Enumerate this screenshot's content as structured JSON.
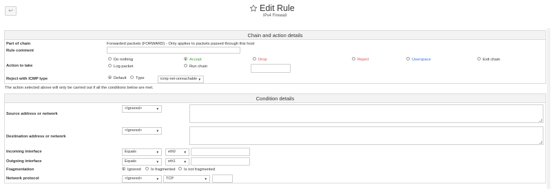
{
  "header": {
    "back_icon": "arrow-left",
    "title": "Edit Rule",
    "subtitle": "IPv4 Firewall",
    "star_icon": "star-outline"
  },
  "chain_section": {
    "heading": "Chain and action details",
    "part_of_chain_label": "Part of chain",
    "part_of_chain_value": "Forwarded packets (FORWARD) - Only applies to packets passed through this host",
    "rule_comment_label": "Rule comment",
    "rule_comment_value": "",
    "action_label": "Action to take",
    "actions": [
      {
        "label": "Do nothing",
        "selected": false,
        "color": "#333333"
      },
      {
        "label": "Accept",
        "selected": true,
        "color": "#3aa33a"
      },
      {
        "label": "Drop",
        "selected": false,
        "color": "#d9534f"
      },
      {
        "label": "Reject",
        "selected": false,
        "color": "#d9534f"
      },
      {
        "label": "Userspace",
        "selected": false,
        "color": "#3a6fd6"
      },
      {
        "label": "Exit chain",
        "selected": false,
        "color": "#333333"
      },
      {
        "label": "Log packet",
        "selected": false,
        "color": "#333333"
      },
      {
        "label": "Run chain",
        "selected": false,
        "color": "#333333"
      }
    ],
    "run_chain_value": "",
    "icmp_label": "Reject with ICMP type",
    "icmp_default_label": "Default",
    "icmp_type_label": "Type",
    "icmp_type_value": "icmp-net-unreachable"
  },
  "note": "The action selected above will only be carried out if all the conditions below are met.",
  "condition_section": {
    "heading": "Condition details",
    "source_label": "Source address or network",
    "source_select": "<Ignored>",
    "source_text": "",
    "dest_label": "Destination address or network",
    "dest_select": "<Ignored>",
    "dest_text": "",
    "incoming_label": "Incoming interface",
    "incoming_mode": "Equals",
    "incoming_iface": "eth0",
    "incoming_other": "",
    "outgoing_label": "Outgoing interface",
    "outgoing_mode": "Equals",
    "outgoing_iface": "eth1",
    "outgoing_other": "",
    "frag_label": "Fragmentation",
    "frag_options": [
      {
        "label": "Ignored",
        "selected": true
      },
      {
        "label": "Is fragmented",
        "selected": false
      },
      {
        "label": "Is not fragmented",
        "selected": false
      }
    ],
    "proto_label": "Network protocol",
    "proto_mode": "<Ignored>",
    "proto_value": "TCP",
    "proto_other": ""
  }
}
